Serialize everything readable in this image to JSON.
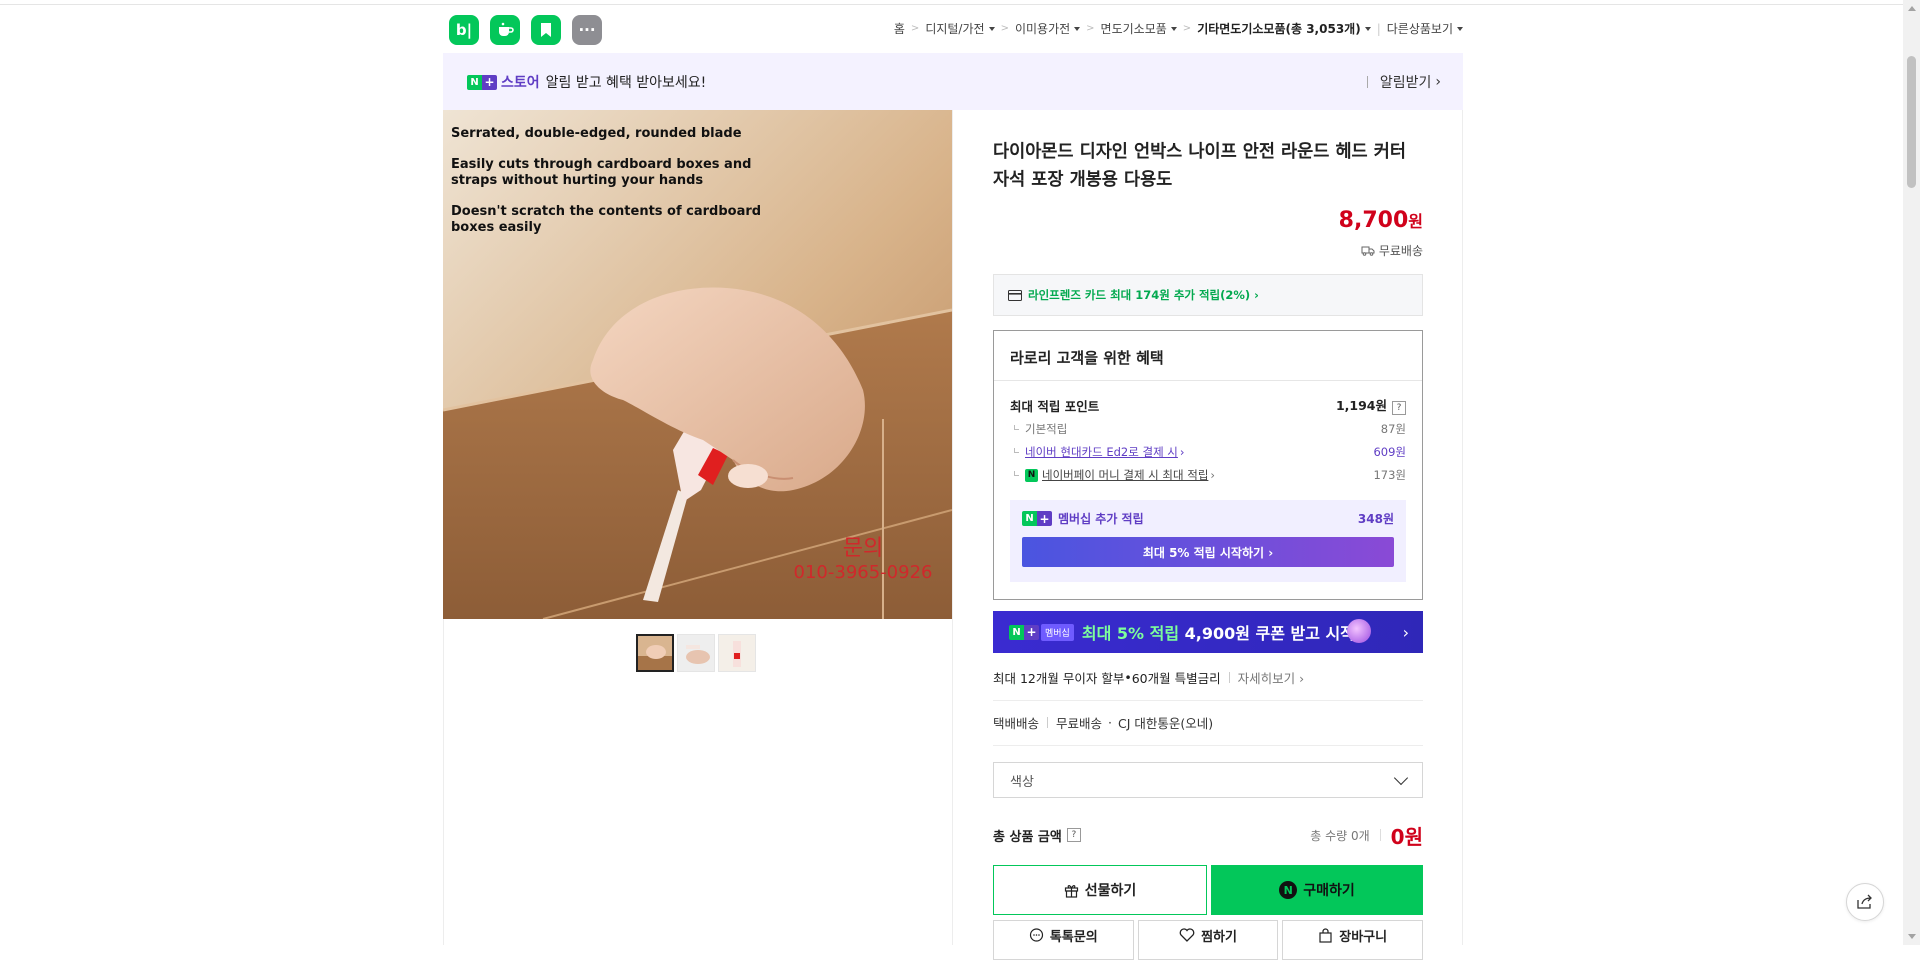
{
  "header": {
    "apps": [
      {
        "name": "blog-app",
        "label": "b|"
      },
      {
        "name": "cafe-app",
        "label": ""
      },
      {
        "name": "bookmark-app",
        "label": ""
      },
      {
        "name": "more-apps",
        "label": "···"
      }
    ],
    "breadcrumb": {
      "home": "홈",
      "c1": "디지털/가전",
      "c2": "이미용가전",
      "c3": "면도기소모품",
      "c4": "기타면도기소모품(총 3,053개)",
      "other": "다른상품보기"
    }
  },
  "store_banner": {
    "n": "N",
    "plus": "+",
    "store_word": "스토어",
    "message": "알림 받고 혜택 받아보세요!",
    "alarm_label": "알림받기",
    "alarm_chevron": "›"
  },
  "image": {
    "caption1": "Serrated, double-edged, rounded blade",
    "caption2a": "Easily cuts through cardboard boxes and",
    "caption2b": "straps without hurting your hands",
    "caption3a": "Doesn't scratch the contents of cardboard",
    "caption3b": "boxes easily",
    "contact1": "문의",
    "contact2": "010-3965-0926"
  },
  "product": {
    "title": "다이아몬드 디자인 언박스 나이프 안전 라운드 헤드 커터 자석 포장 개봉용 다용도",
    "price": "8,700",
    "price_unit": "원",
    "shipping_tag": "무료배송",
    "card_offer": "라인프렌즈 카드 최대 174원 추가 적립(2%) ›"
  },
  "benefit": {
    "head": "라로리 고객을 위한 혜택",
    "max_label": "최대 적립 포인트",
    "max_value": "1,194원",
    "qmark": "?",
    "base_label": "기본적립",
    "base_value": "87원",
    "hyundai_label": "네이버 현대카드 Ed2로 결제 시",
    "hyundai_value": "609원",
    "npay_label": "네이버페이 머니 결제 시 최대 적립",
    "npay_value": "173원",
    "npay_icon": "N",
    "chev": "›",
    "member_label": "멤버십 추가 적립",
    "member_value": "348원",
    "member_btn": "최대 5% 적립 시작하기 ›"
  },
  "promo": {
    "tag": "멤버십",
    "text_a": "최대 ",
    "text_b": "5% 적립",
    "text_c": " 4,900원 쿠폰 받고 시작",
    "chev": "›"
  },
  "install": {
    "a": "최대 12개월 무이자 할부",
    "dot": " • ",
    "b": "60개월 특별금리",
    "more": "자세히보기 ›"
  },
  "shipping": {
    "type": "택배배송",
    "fee": "무료배송",
    "carrier": "CJ 대한통운(오네)",
    "dot": "·"
  },
  "option": {
    "label": "색상"
  },
  "total": {
    "label": "총 상품 금액",
    "qmark": "?",
    "qty": "총 수량 0개",
    "amount": "0원"
  },
  "buttons": {
    "gift": "선물하기",
    "buy": "구매하기",
    "buy_icon": "N",
    "talk": "톡톡문의",
    "wish": "찜하기",
    "cart": "장바구니"
  },
  "colors": {
    "naver_green": "#03c75a",
    "price_red": "#d0021b",
    "membership_purple": "#5f3dc4"
  }
}
